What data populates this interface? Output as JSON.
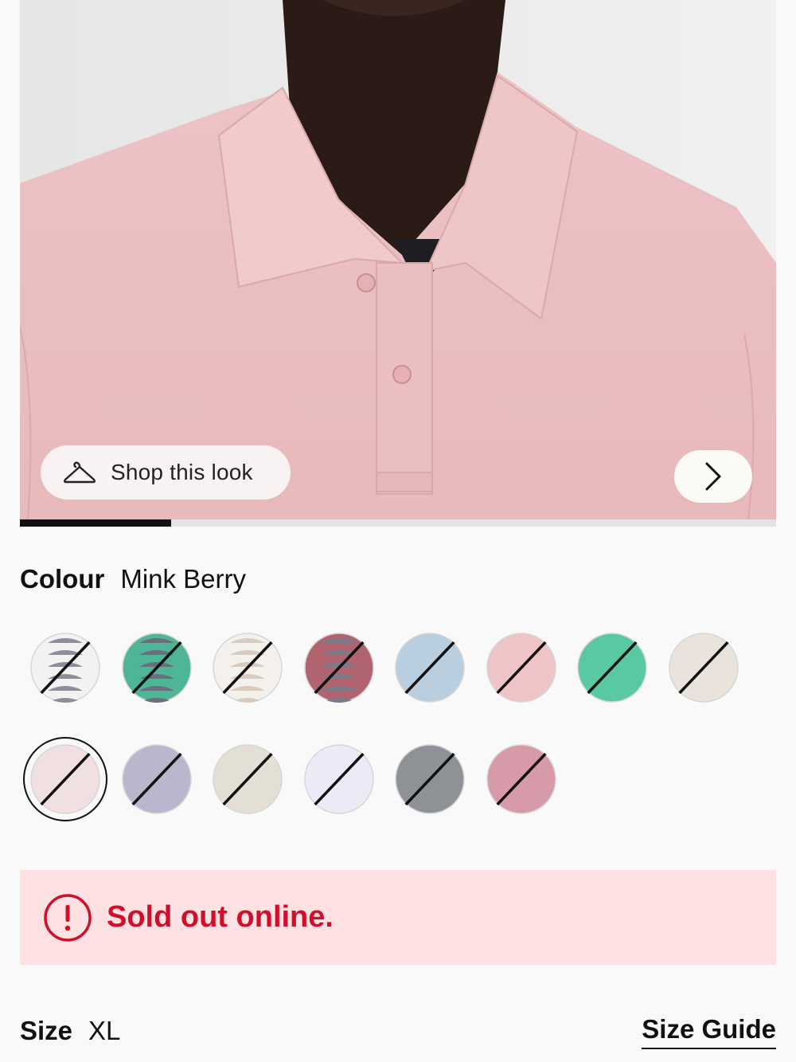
{
  "product_image": {
    "shop_look_label": "Shop this look",
    "carousel_progress": 0.2
  },
  "colour": {
    "label": "Colour",
    "selected": "Mink Berry",
    "swatches": [
      {
        "pattern": "stripe",
        "base": "#f2f2f2",
        "stripe": "#8c8f9a",
        "unavailable": true
      },
      {
        "pattern": "stripe",
        "base": "#4fb597",
        "stripe": "#6a6f80",
        "unavailable": true
      },
      {
        "pattern": "stripe",
        "base": "#f4f1ec",
        "stripe": "#d8cbbd",
        "unavailable": true
      },
      {
        "pattern": "stripe",
        "base": "#b06470",
        "stripe": "#7a7a8a",
        "unavailable": true
      },
      {
        "pattern": "solid",
        "base": "#b9cfe0",
        "unavailable": true
      },
      {
        "pattern": "solid",
        "base": "#efc4c6",
        "unavailable": true
      },
      {
        "pattern": "solid",
        "base": "#58c8a5",
        "unavailable": true
      },
      {
        "pattern": "solid",
        "base": "#e9e3dc",
        "unavailable": true
      },
      {
        "pattern": "solid",
        "base": "#f0e0e1",
        "unavailable": true,
        "selected": true
      },
      {
        "pattern": "solid",
        "base": "#b9b7cd",
        "unavailable": true
      },
      {
        "pattern": "solid",
        "base": "#e3dfd4",
        "unavailable": true
      },
      {
        "pattern": "solid",
        "base": "#ebebf7",
        "unavailable": true
      },
      {
        "pattern": "solid",
        "base": "#8e9196",
        "unavailable": true
      },
      {
        "pattern": "solid",
        "base": "#d79aa8",
        "unavailable": true
      }
    ]
  },
  "alert": {
    "message": "Sold out online.",
    "color": "#d0102a",
    "background": "#fde1e3"
  },
  "size": {
    "label": "Size",
    "selected": "XL",
    "guide_label": "Size Guide"
  }
}
